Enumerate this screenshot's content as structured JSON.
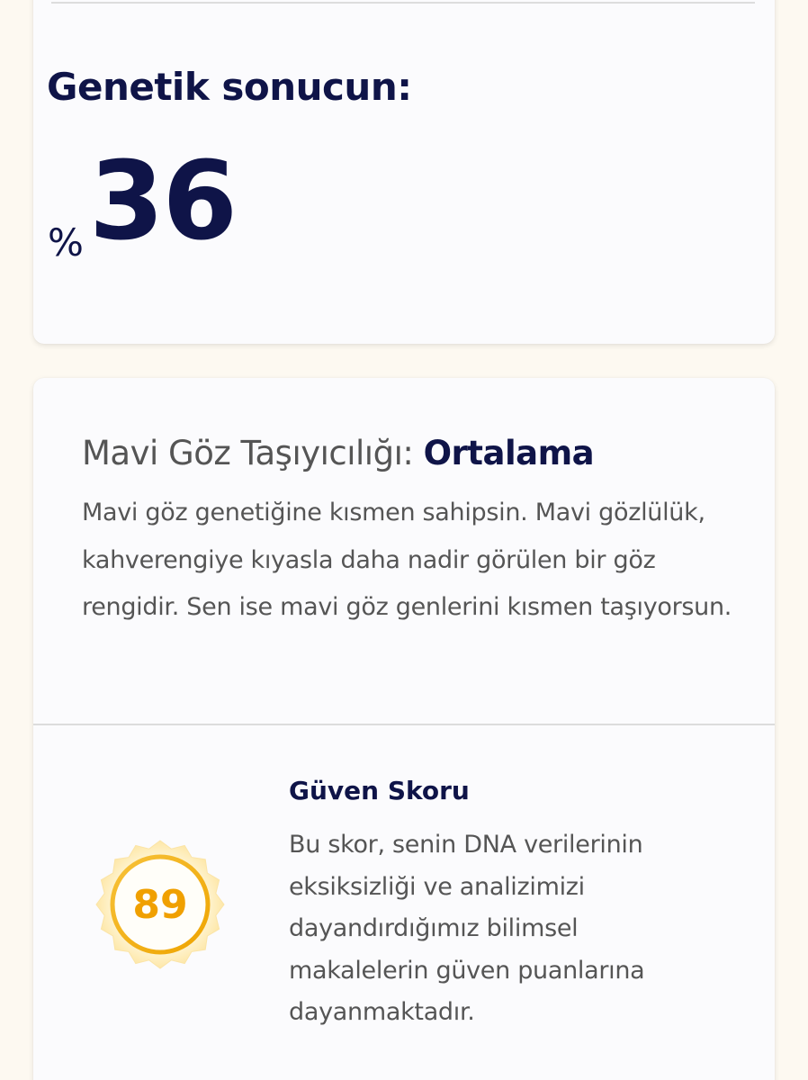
{
  "result": {
    "title": "Genetik sonucun:",
    "percent_symbol": "%",
    "value": "36"
  },
  "trait": {
    "label": "Mavi Göz Taşıyıcılığı:",
    "level": "Ortalama",
    "description": "Mavi göz genetiğine kısmen sahipsin. Mavi gözlülük, kahverengiye kıyasla daha nadir görülen bir göz rengidir. Sen ise mavi göz genlerini kısmen taşıyorsun."
  },
  "confidence": {
    "score": "89",
    "title": "Güven Skoru",
    "description": "Bu skor, senin DNA verilerinin eksiksizliği ve analizimizi dayandırdığımız bilimsel makalelerin güven puanlarına dayanmaktadır."
  },
  "colors": {
    "background": "#fdf9f1",
    "card": "#fbfbfd",
    "navy": "#0f1448",
    "body_text": "#555555",
    "badge_gold": "#f0a000"
  },
  "icons": {
    "badge": "seal-badge-icon"
  }
}
